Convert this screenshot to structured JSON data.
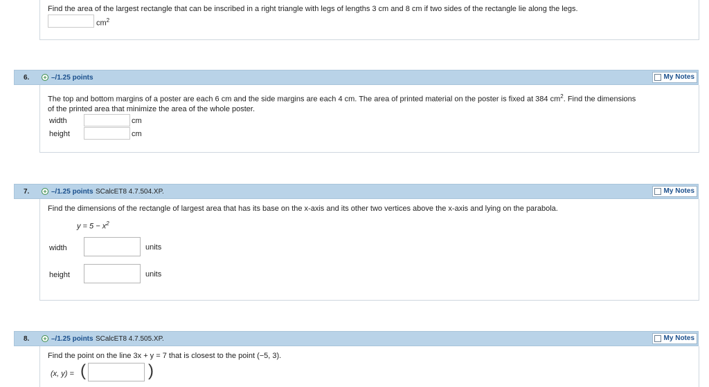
{
  "q5": {
    "text": "Find the area of the largest rectangle that can be inscribed in a right triangle with legs of lengths 3 cm and 8 cm if two sides of the rectangle lie along the legs.",
    "unit": "cm",
    "unit_sup": "2"
  },
  "q6": {
    "number": "6.",
    "points": "–/1.25 points",
    "notes": "My Notes",
    "text_line1": "The top and bottom margins of a poster are each 6 cm and the side margins are each 4 cm. The area of printed material on the poster is fixed at 384 cm",
    "text_sup": "2",
    "text_line1_end": ". Find the dimensions",
    "text_line2": "of the printed area that minimize the area of the whole poster.",
    "width_label": "width",
    "height_label": "height",
    "width_unit": "cm",
    "height_unit": "cm"
  },
  "q7": {
    "number": "7.",
    "points": "–/1.25 points",
    "code": "SCalcET8 4.7.504.XP.",
    "notes": "My Notes",
    "text": "Find the dimensions of the rectangle of largest area that has its base on the x-axis and its other two vertices above the x-axis and lying on the parabola.",
    "equation": "y = 5 − x",
    "equation_sup": "2",
    "width_label": "width",
    "height_label": "height",
    "width_unit": "units",
    "height_unit": "units"
  },
  "q8": {
    "number": "8.",
    "points": "–/1.25 points",
    "code": "SCalcET8 4.7.505.XP.",
    "notes": "My Notes",
    "text": "Find the point on the line 3x + y = 7 that is closest to the point (−5, 3).",
    "answer_label": "(x, y) =",
    "open_paren": "(",
    "close_paren": ")"
  }
}
